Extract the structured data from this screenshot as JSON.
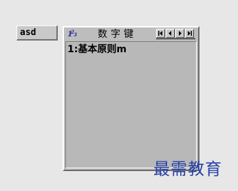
{
  "composition": {
    "text": "asd"
  },
  "candidate_window": {
    "title": "数字键",
    "logo_icon": "ime-logo-icon",
    "nav_buttons": [
      "first-page-icon",
      "prev-page-icon",
      "next-page-icon",
      "last-page-icon"
    ],
    "items": [
      "1:基本原则m"
    ]
  },
  "watermark": {
    "text": "最需教育"
  },
  "colors": {
    "background": "#e7e7e7",
    "window_face": "#bdbdbd",
    "watermark": "#2740a8",
    "logo_blue": "#2a2aa0"
  }
}
